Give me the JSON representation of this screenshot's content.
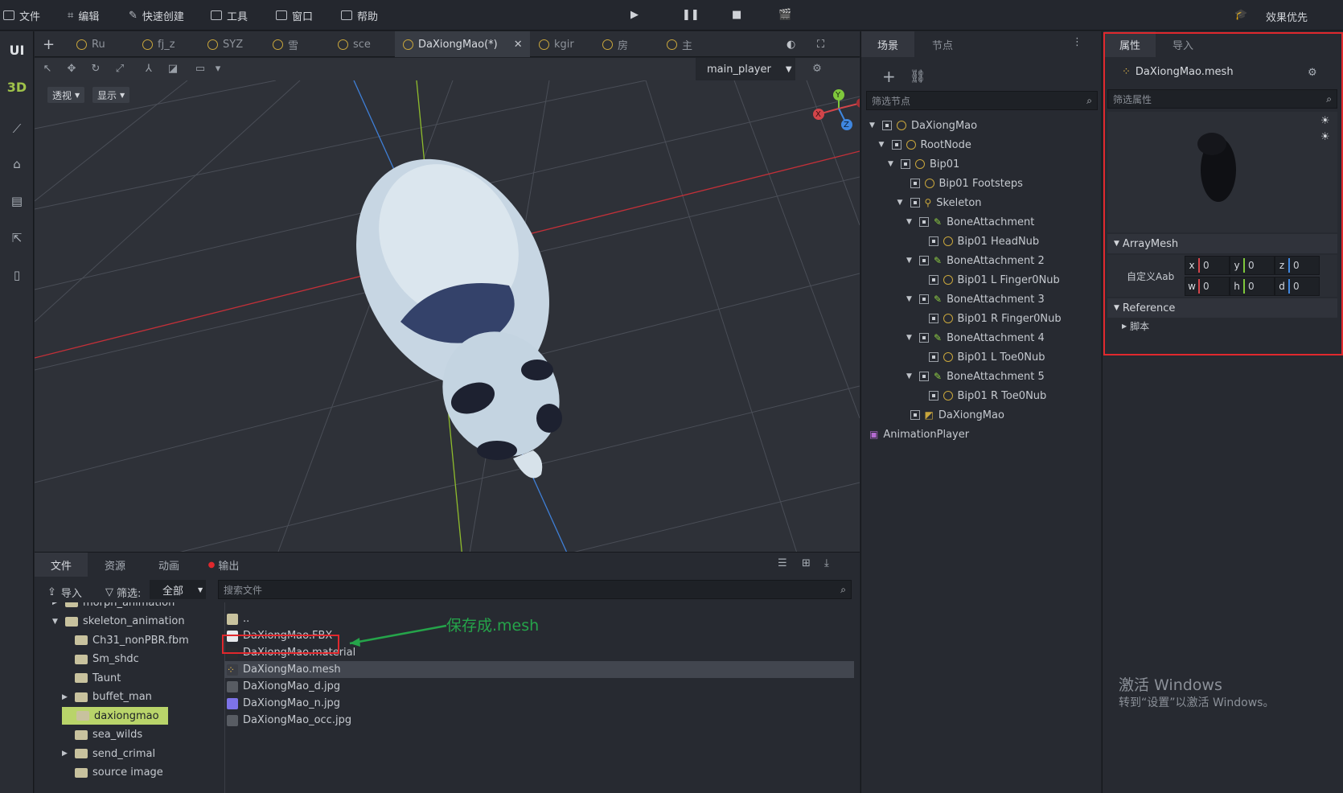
{
  "menubar": {
    "items": [
      "文件",
      "编辑",
      "快速创建",
      "工具",
      "窗口",
      "帮助"
    ],
    "quality": "效果优先"
  },
  "leftbar": {
    "ui": "UI",
    "three_d": "3D"
  },
  "tabs": [
    "Ru",
    "fj_z",
    "SYZ",
    "雪",
    "sce",
    "DaXiongMao(*)",
    "kgir",
    "房",
    "主"
  ],
  "viewport": {
    "camera": "main_player",
    "perspective": "透视",
    "display": "显示",
    "gizmo": {
      "x": "X",
      "y": "Y",
      "z": "Z"
    }
  },
  "scene_panel": {
    "tabs": [
      "场景",
      "节点"
    ],
    "filter_placeholder": "筛选节点",
    "tree": [
      {
        "label": "DaXiongMao",
        "depth": 0,
        "icon": "node-icon",
        "expanded": true
      },
      {
        "label": "RootNode",
        "depth": 1,
        "icon": "node-icon",
        "expanded": true
      },
      {
        "label": "Bip01",
        "depth": 2,
        "icon": "node-icon",
        "expanded": true
      },
      {
        "label": "Bip01 Footsteps",
        "depth": 3,
        "icon": "node-icon",
        "expanded": null
      },
      {
        "label": "Skeleton",
        "depth": 3,
        "icon": "skeleton-icon",
        "expanded": true
      },
      {
        "label": "BoneAttachment",
        "depth": 4,
        "icon": "bone-icon",
        "expanded": true
      },
      {
        "label": "Bip01 HeadNub",
        "depth": 5,
        "icon": "node-icon",
        "expanded": null
      },
      {
        "label": "BoneAttachment 2",
        "depth": 4,
        "icon": "bone-icon",
        "expanded": true
      },
      {
        "label": "Bip01 L Finger0Nub",
        "depth": 5,
        "icon": "node-icon",
        "expanded": null
      },
      {
        "label": "BoneAttachment 3",
        "depth": 4,
        "icon": "bone-icon",
        "expanded": true
      },
      {
        "label": "Bip01 R Finger0Nub",
        "depth": 5,
        "icon": "node-icon",
        "expanded": null
      },
      {
        "label": "BoneAttachment 4",
        "depth": 4,
        "icon": "bone-icon",
        "expanded": true
      },
      {
        "label": "Bip01 L Toe0Nub",
        "depth": 5,
        "icon": "node-icon",
        "expanded": null
      },
      {
        "label": "BoneAttachment 5",
        "depth": 4,
        "icon": "bone-icon",
        "expanded": true
      },
      {
        "label": "Bip01 R Toe0Nub",
        "depth": 5,
        "icon": "node-icon",
        "expanded": null
      },
      {
        "label": "DaXiongMao",
        "depth": 3,
        "icon": "mesh-icon",
        "expanded": null
      },
      {
        "label": "AnimationPlayer",
        "depth": 0,
        "icon": "animation-icon",
        "expanded": null
      }
    ]
  },
  "props_panel": {
    "tabs": [
      "属性",
      "导入"
    ],
    "resource_name": "DaXiongMao.mesh",
    "filter_placeholder": "筛选属性",
    "section_arraymesh": "ArrayMesh",
    "custom_aabb_label": "自定义Aab",
    "aabb": [
      {
        "label": "x",
        "value": "0",
        "color": "#d2454a"
      },
      {
        "label": "y",
        "value": "0",
        "color": "#7fc83c"
      },
      {
        "label": "z",
        "value": "0",
        "color": "#3f87e0"
      },
      {
        "label": "w",
        "value": "0",
        "color": "#d2454a"
      },
      {
        "label": "h",
        "value": "0",
        "color": "#7fc83c"
      },
      {
        "label": "d",
        "value": "0",
        "color": "#3f87e0"
      }
    ],
    "section_reference": "Reference",
    "script_label": "脚本"
  },
  "bottom_panel": {
    "tabs": [
      "文件",
      "资源",
      "动画",
      "输出"
    ],
    "import_label": "导入",
    "filter_label": "筛选:",
    "filter_value": "全部",
    "search_placeholder": "搜索文件",
    "folders": [
      {
        "label": "morph_animation",
        "depth": 1,
        "expanded": false
      },
      {
        "label": "skeleton_animation",
        "depth": 1,
        "expanded": true
      },
      {
        "label": "Ch31_nonPBR.fbm",
        "depth": 2,
        "expanded": null
      },
      {
        "label": "Sm_shdc",
        "depth": 2,
        "expanded": null
      },
      {
        "label": "Taunt",
        "depth": 2,
        "expanded": null
      },
      {
        "label": "buffet_man",
        "depth": 2,
        "expanded": false
      },
      {
        "label": "daxiongmao",
        "depth": 2,
        "expanded": null,
        "selected": true
      },
      {
        "label": "sea_wilds",
        "depth": 2,
        "expanded": null
      },
      {
        "label": "send_crimal",
        "depth": 2,
        "expanded": false
      },
      {
        "label": "source image",
        "depth": 2,
        "expanded": null
      }
    ],
    "files": [
      {
        "label": "..",
        "icon": "folder-icon"
      },
      {
        "label": "DaXiongMao.FBX",
        "icon": "fbx-icon"
      },
      {
        "label": "DaXiongMao.material",
        "icon": "material-icon"
      },
      {
        "label": "DaXiongMao.mesh",
        "icon": "mesh-icon",
        "selected": true
      },
      {
        "label": "DaXiongMao_d.jpg",
        "icon": "image-icon"
      },
      {
        "label": "DaXiongMao_n.jpg",
        "icon": "normal-map-icon"
      },
      {
        "label": "DaXiongMao_occ.jpg",
        "icon": "image-icon"
      }
    ],
    "annotation": "保存成.mesh"
  },
  "watermark": {
    "line1": "激活 Windows",
    "line2": "转到“设置”以激活 Windows。"
  }
}
